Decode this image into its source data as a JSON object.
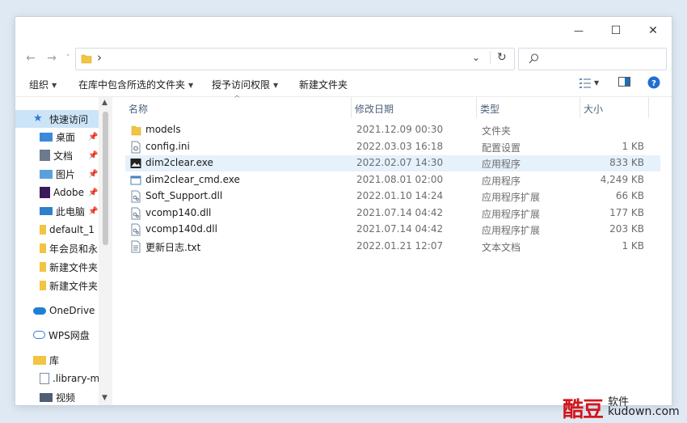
{
  "window": {
    "minimize": "—",
    "maximize": "☐",
    "close": "✕"
  },
  "address": {
    "path_separator": "›",
    "search_placeholder": ""
  },
  "toolbar": {
    "organize": "组织",
    "include_in_library": "在库中包含所选的文件夹",
    "grant_access": "授予访问权限",
    "new_folder": "新建文件夹"
  },
  "sidebar": {
    "items": [
      {
        "label": "快速访问",
        "icon": "star-icon"
      },
      {
        "label": "桌面",
        "icon": "desktop-icon"
      },
      {
        "label": "文档",
        "icon": "document-icon"
      },
      {
        "label": "图片",
        "icon": "picture-icon"
      },
      {
        "label": "Adobe",
        "icon": "adobe-icon"
      },
      {
        "label": "此电脑",
        "icon": "computer-icon"
      },
      {
        "label": "default_1",
        "icon": "folder-icon"
      },
      {
        "label": "年会员和永",
        "icon": "folder-icon"
      },
      {
        "label": "新建文件夹",
        "icon": "folder-icon"
      },
      {
        "label": "新建文件夹",
        "icon": "folder-icon"
      },
      {
        "label": "OneDrive",
        "icon": "cloud-icon"
      },
      {
        "label": "WPS网盘",
        "icon": "cloud-icon"
      },
      {
        "label": "库",
        "icon": "library-icon"
      },
      {
        "label": ".library-m",
        "icon": "file-icon"
      },
      {
        "label": "视频",
        "icon": "video-icon"
      }
    ]
  },
  "columns": {
    "name": "名称",
    "date": "修改日期",
    "type": "类型",
    "size": "大小"
  },
  "files": [
    {
      "name": "models",
      "date": "2021.12.09 00:30",
      "type": "文件夹",
      "size": "",
      "icon": "folder-icon"
    },
    {
      "name": "config.ini",
      "date": "2022.03.03 16:18",
      "type": "配置设置",
      "size": "1 KB",
      "icon": "settings-file-icon"
    },
    {
      "name": "dim2clear.exe",
      "date": "2022.02.07 14:30",
      "type": "应用程序",
      "size": "833 KB",
      "icon": "app-image-icon"
    },
    {
      "name": "dim2clear_cmd.exe",
      "date": "2021.08.01 02:00",
      "type": "应用程序",
      "size": "4,249 KB",
      "icon": "app-window-icon"
    },
    {
      "name": "Soft_Support.dll",
      "date": "2022.01.10 14:24",
      "type": "应用程序扩展",
      "size": "66 KB",
      "icon": "dll-icon"
    },
    {
      "name": "vcomp140.dll",
      "date": "2021.07.14 04:42",
      "type": "应用程序扩展",
      "size": "177 KB",
      "icon": "dll-icon"
    },
    {
      "name": "vcomp140d.dll",
      "date": "2021.07.14 04:42",
      "type": "应用程序扩展",
      "size": "203 KB",
      "icon": "dll-icon"
    },
    {
      "name": "更新日志.txt",
      "date": "2022.01.21 12:07",
      "type": "文本文档",
      "size": "1 KB",
      "icon": "text-file-icon"
    }
  ],
  "watermark": {
    "brand": "酷豆",
    "tag": "软件",
    "url": "kudown.com"
  },
  "colors": {
    "accent": "#0078d4",
    "selection": "#e5f1fb",
    "sidebar_active": "#cce4f7",
    "folder": "#f2c441"
  }
}
